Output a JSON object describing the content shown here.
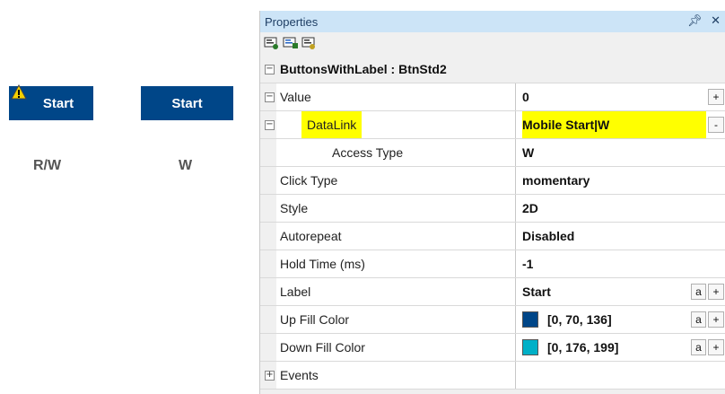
{
  "canvas": {
    "buttons": [
      {
        "label": "Start",
        "caption": "R/W",
        "has_warning": true
      },
      {
        "label": "Start",
        "caption": "W",
        "has_warning": false
      }
    ],
    "button_color": "#004688"
  },
  "panel": {
    "title": "Properties",
    "pin_icon": "pin-icon",
    "close_icon": "close-icon",
    "toolbar_icons": [
      "categorized-view-icon",
      "alphabetical-view-icon",
      "property-pages-icon"
    ],
    "object_header": "ButtonsWithLabel : BtnStd2",
    "rows": {
      "value": {
        "name": "Value",
        "value": "0",
        "btn": "+"
      },
      "datalink": {
        "name": "DataLink",
        "value": "Mobile Start|W",
        "btn": "-"
      },
      "access_type": {
        "name": "Access Type",
        "value": "W"
      },
      "click_type": {
        "name": "Click Type",
        "value": "momentary"
      },
      "style": {
        "name": "Style",
        "value": "2D"
      },
      "autorepeat": {
        "name": "Autorepeat",
        "value": "Disabled"
      },
      "hold_time": {
        "name": "Hold Time (ms)",
        "value": "-1"
      },
      "label": {
        "name": "Label",
        "value": "Start",
        "btn_a": "a",
        "btn_plus": "+"
      },
      "up_fill": {
        "name": "Up Fill Color",
        "value": "[0, 70, 136]",
        "color": "#004688",
        "btn_a": "a",
        "btn_plus": "+"
      },
      "down_fill": {
        "name": "Down Fill Color",
        "value": "[0, 176, 199]",
        "color": "#00B0C7",
        "btn_a": "a",
        "btn_plus": "+"
      },
      "events": {
        "name": "Events"
      }
    },
    "highlight_color": "#FFFF00"
  }
}
